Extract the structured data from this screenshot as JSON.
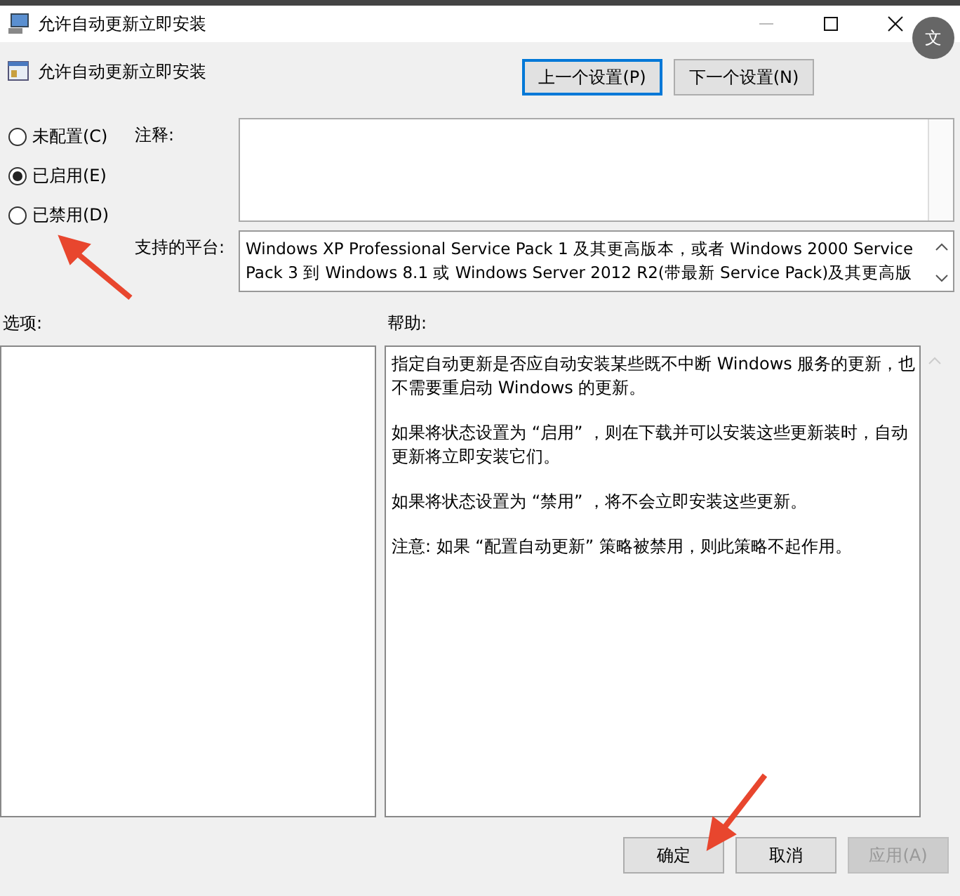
{
  "window": {
    "title": "允许自动更新立即安装"
  },
  "header": {
    "title": "允许自动更新立即安装"
  },
  "nav_buttons": [
    {
      "label": "上一个设置(P)",
      "selected": true
    },
    {
      "label": "下一个设置(N)",
      "selected": false
    }
  ],
  "radios": [
    {
      "label": "未配置(C)",
      "selected": false
    },
    {
      "label": "已启用(E)",
      "selected": true
    },
    {
      "label": "已禁用(D)",
      "selected": false
    }
  ],
  "comment": {
    "label": "注释:"
  },
  "platform": {
    "label": "支持的平台:",
    "value": "Windows XP Professional Service Pack 1 及其更高版本，或者 Windows 2000 Service Pack 3 到 Windows 8.1 或 Windows Server 2012 R2(带最新 Service Pack)及其更高版"
  },
  "options": {
    "label": "选项:"
  },
  "help": {
    "label": "帮助:",
    "paragraphs": [
      "指定自动更新是否应自动安装某些既不中断 Windows 服务的更新，也不需要重启动 Windows 的更新。",
      "如果将状态设置为 “启用” ，则在下载并可以安装这些更新装时，自动更新将立即安装它们。",
      "如果将状态设置为 “禁用” ，将不会立即安装这些更新。",
      "注意: 如果 “配置自动更新” 策略被禁用，则此策略不起作用。"
    ]
  },
  "buttons": [
    {
      "label": "确定",
      "disabled": false
    },
    {
      "label": "取消",
      "disabled": false
    },
    {
      "label": "应用(A)",
      "disabled": true
    }
  ],
  "translate_badge": {
    "label": "文"
  }
}
